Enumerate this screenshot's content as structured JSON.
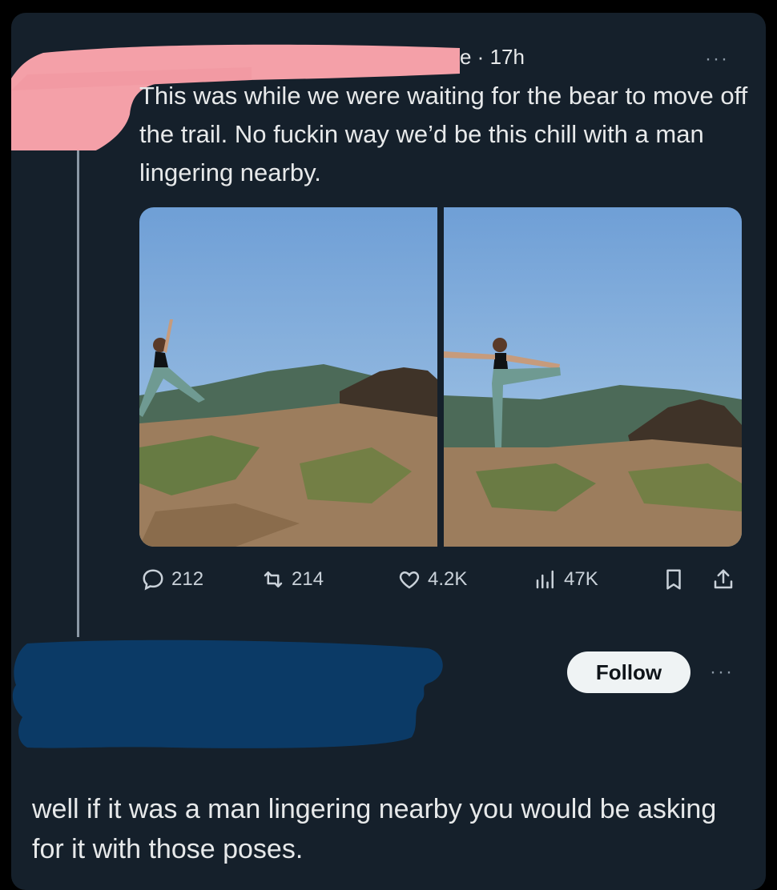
{
  "tweet": {
    "time": "e · 17h",
    "more_glyph": "···",
    "text": "This was while we were waiting for the bear to move off the trail. No fuckin way we’d be this chill with a man lingering nearby.",
    "media": {
      "count": 2
    },
    "stats": {
      "replies": "212",
      "reposts": "214",
      "likes": "4.2K",
      "views": "47K"
    },
    "icons": [
      "reply-icon",
      "repost-icon",
      "like-icon",
      "views-icon",
      "bookmark-icon",
      "share-icon"
    ]
  },
  "reply": {
    "follow_label": "Follow",
    "more_glyph": "···",
    "text": "well if it was a man lingering nearby you would be asking for it with those poses."
  },
  "colors": {
    "background": "#15202b",
    "text": "#e7e9ea",
    "muted": "#8b98a5",
    "redaction_pink": "#f4a0a8",
    "redaction_blue": "#0b3a66"
  }
}
